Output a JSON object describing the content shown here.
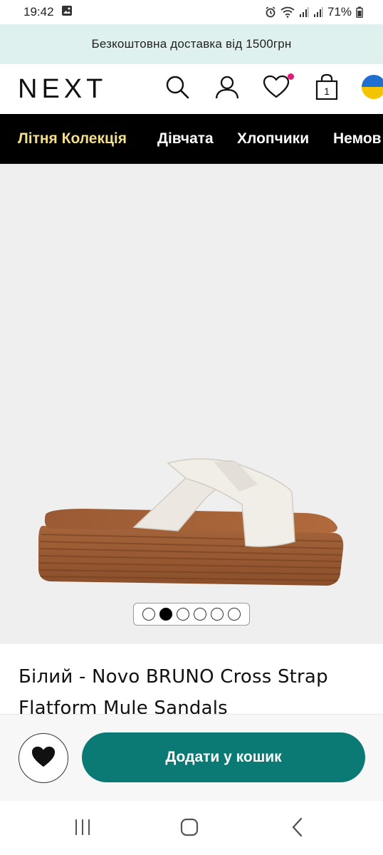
{
  "status_bar": {
    "time": "19:42",
    "battery": "71%"
  },
  "promo": {
    "text": "Безкоштовна доставка від 1500грн"
  },
  "header": {
    "logo": "NEXT",
    "bag_count": "1",
    "icons": [
      "search-icon",
      "account-icon",
      "wishlist-heart-icon",
      "shopping-bag-icon",
      "ukraine-flag-icon"
    ],
    "wishlist_badge_color": "#e5197a"
  },
  "nav": {
    "items": [
      {
        "label": "Літня Колекція",
        "active": true
      },
      {
        "label": "Дівчата"
      },
      {
        "label": "Хлопчики"
      },
      {
        "label": "Немов"
      }
    ],
    "active_color": "#f3de8a"
  },
  "gallery": {
    "image": "white-cross-strap-flatform-mule-sandal",
    "slide_count": 6,
    "active_slide": 2
  },
  "product": {
    "title": "Білий - Novo BRUNO Cross Strap Flatform Mule Sandals"
  },
  "actions": {
    "add_to_bag_label": "Додати у кошик",
    "accent_color": "#0b7a75"
  }
}
